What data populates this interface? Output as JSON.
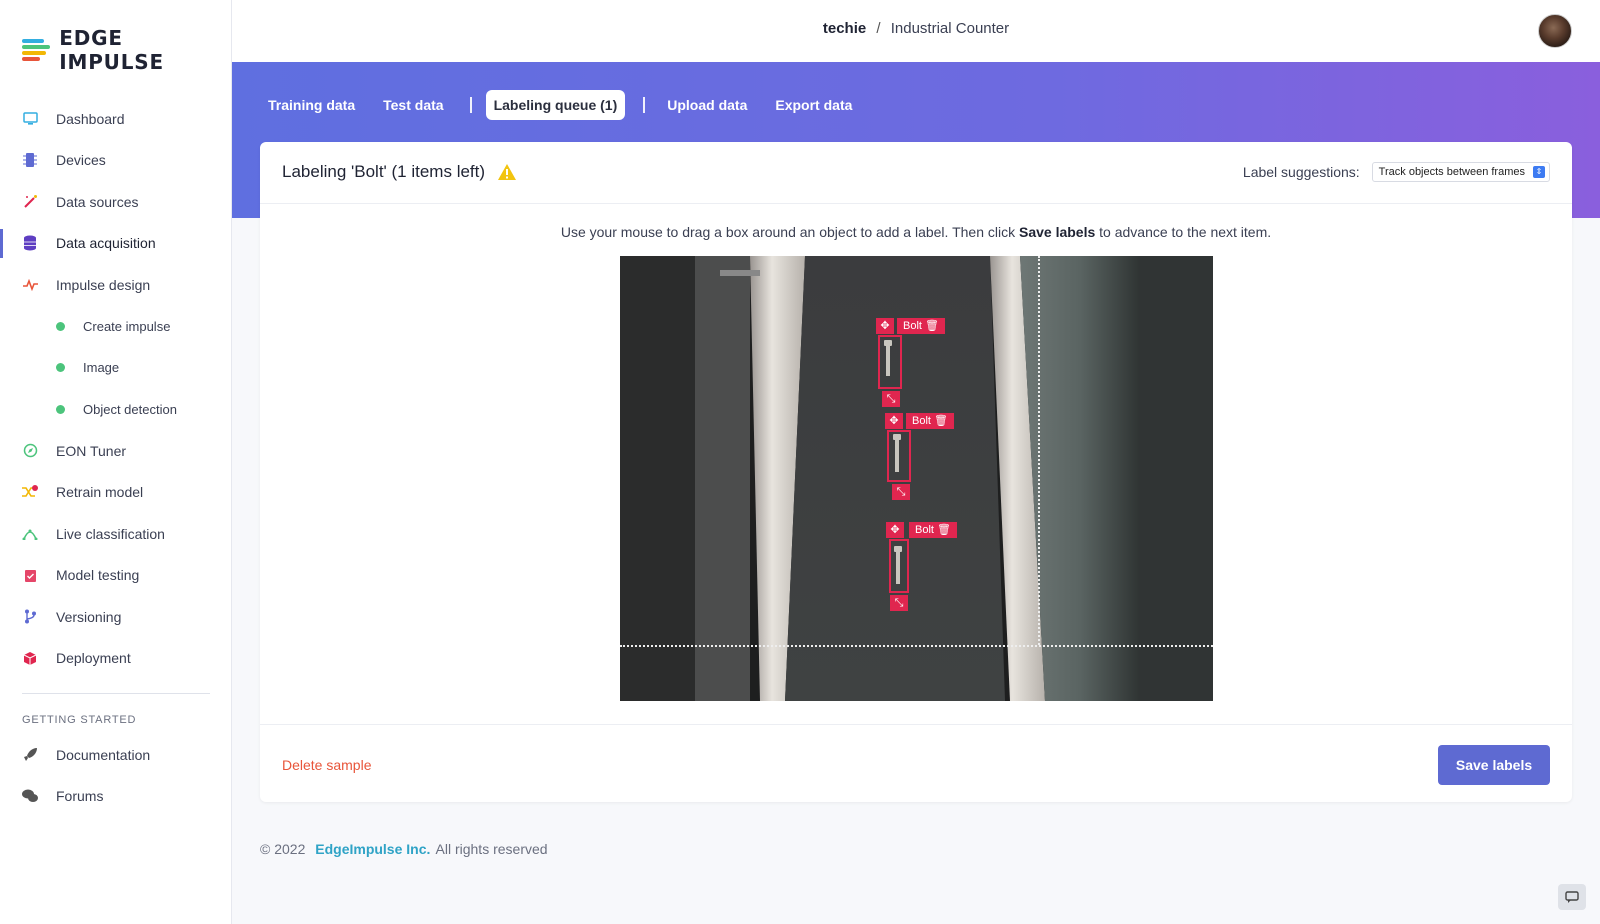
{
  "app": {
    "logo_text": "EDGE IMPULSE"
  },
  "sidebar": {
    "items": [
      {
        "label": "Dashboard",
        "icon": "monitor-icon",
        "color": "#33aee0"
      },
      {
        "label": "Devices",
        "icon": "chip-icon",
        "color": "#5e6ad2"
      },
      {
        "label": "Data sources",
        "icon": "magic-wand-icon",
        "color": "#e0264f"
      },
      {
        "label": "Data acquisition",
        "icon": "database-icon",
        "color": "#5e3ec2",
        "active": true
      },
      {
        "label": "Impulse design",
        "icon": "pulse-icon",
        "color": "#e8553a"
      }
    ],
    "sub_items": [
      {
        "label": "Create impulse"
      },
      {
        "label": "Image"
      },
      {
        "label": "Object detection"
      }
    ],
    "items2": [
      {
        "label": "EON Tuner",
        "icon": "compass-icon",
        "color": "#4cc47c"
      },
      {
        "label": "Retrain model",
        "icon": "shuffle-icon",
        "color": "#f2b705"
      },
      {
        "label": "Live classification",
        "icon": "radar-icon",
        "color": "#4cc47c"
      },
      {
        "label": "Model testing",
        "icon": "clipboard-check-icon",
        "color": "#e0264f"
      },
      {
        "label": "Versioning",
        "icon": "branch-icon",
        "color": "#5e6ad2"
      },
      {
        "label": "Deployment",
        "icon": "cube-icon",
        "color": "#e0264f"
      }
    ],
    "getting_started_title": "GETTING STARTED",
    "getting_started": [
      {
        "label": "Documentation",
        "icon": "rocket-icon"
      },
      {
        "label": "Forums",
        "icon": "chat-bubbles-icon"
      }
    ]
  },
  "header": {
    "owner": "techie",
    "separator": "/",
    "project": "Industrial Counter"
  },
  "tabs": [
    {
      "label": "Training data"
    },
    {
      "label": "Test data"
    },
    {
      "label": "Labeling queue (1)",
      "active": true
    },
    {
      "label": "Upload data"
    },
    {
      "label": "Export data"
    }
  ],
  "card": {
    "title": "Labeling 'Bolt' (1 items left)",
    "suggestions_label": "Label suggestions:",
    "suggestions_value": "Track objects between frames",
    "instructions_pre": "Use your mouse to drag a box around an object to add a label. Then click ",
    "instructions_bold": "Save labels",
    "instructions_post": " to advance to the next item.",
    "boxes": [
      {
        "label": "Bolt"
      },
      {
        "label": "Bolt"
      },
      {
        "label": "Bolt"
      }
    ],
    "delete_label": "Delete sample",
    "save_label": "Save labels"
  },
  "footer": {
    "copyright": "© 2022",
    "company": "EdgeImpulse Inc.",
    "rights": "All rights reserved"
  },
  "colors": {
    "accent": "#5e6ad2",
    "bbox": "#e0264f",
    "delete": "#e8553a",
    "link": "#2fa3c6"
  }
}
